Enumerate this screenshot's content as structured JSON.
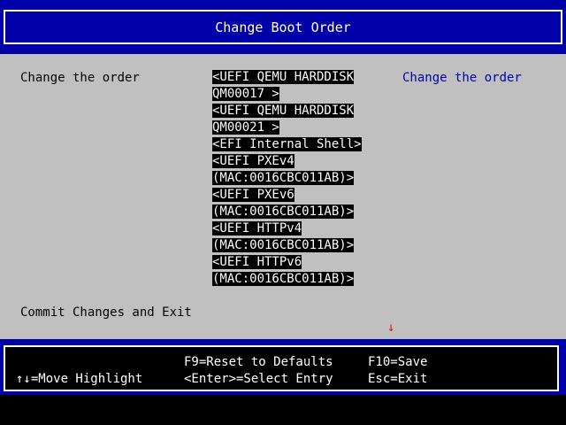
{
  "header": {
    "title": "Change Boot Order"
  },
  "main": {
    "prompt_label": "Change the order",
    "help_text": "Change the order",
    "commit_label": "Commit Changes and Exit",
    "scroll_indicator": "↓",
    "boot_order_lines": [
      "<UEFI QEMU HARDDISK",
      "QM00017 >",
      "<UEFI QEMU HARDDISK",
      "QM00021 >",
      "<EFI Internal Shell>",
      "<UEFI PXEv4",
      "(MAC:0016CBC011AB)>",
      "<UEFI PXEv6",
      "(MAC:0016CBC011AB)>",
      "<UEFI HTTPv4",
      "(MAC:0016CBC011AB)>",
      "<UEFI HTTPv6",
      "(MAC:0016CBC011AB)>"
    ]
  },
  "footer": {
    "move_highlight": "↑↓=Move Highlight",
    "reset_defaults": "F9=Reset to Defaults",
    "select_entry": "<Enter>=Select Entry",
    "save": "F10=Save",
    "exit": "Esc=Exit"
  },
  "colors": {
    "blue": "#0000a8",
    "gray": "#c0c0c0",
    "help_text": "#0000a8",
    "scroll_arrow": "#ff0000"
  }
}
